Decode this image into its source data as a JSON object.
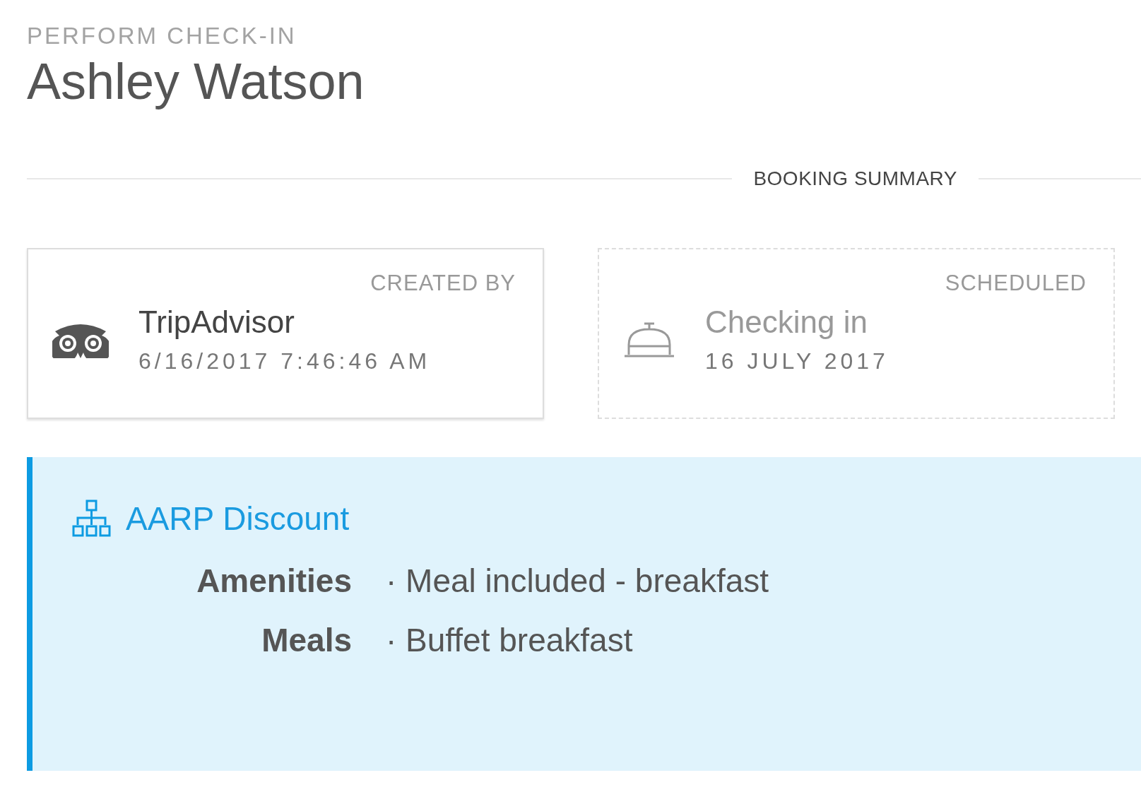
{
  "header": {
    "eyebrow": "PERFORM CHECK-IN",
    "title": "Ashley Watson"
  },
  "section": {
    "label": "BOOKING SUMMARY"
  },
  "cards": [
    {
      "kind": "created",
      "label": "CREATED BY",
      "title": "TripAdvisor",
      "subtitle": "6/16/2017 7:46:46 AM"
    },
    {
      "kind": "scheduled",
      "label": "SCHEDULED",
      "title": "Checking in",
      "subtitle": "16 JULY 2017"
    }
  ],
  "panel": {
    "title": "AARP Discount",
    "rows": [
      {
        "label": "Amenities",
        "value": "· Meal included - breakfast"
      },
      {
        "label": "Meals",
        "value": "· Buffet breakfast"
      }
    ]
  }
}
